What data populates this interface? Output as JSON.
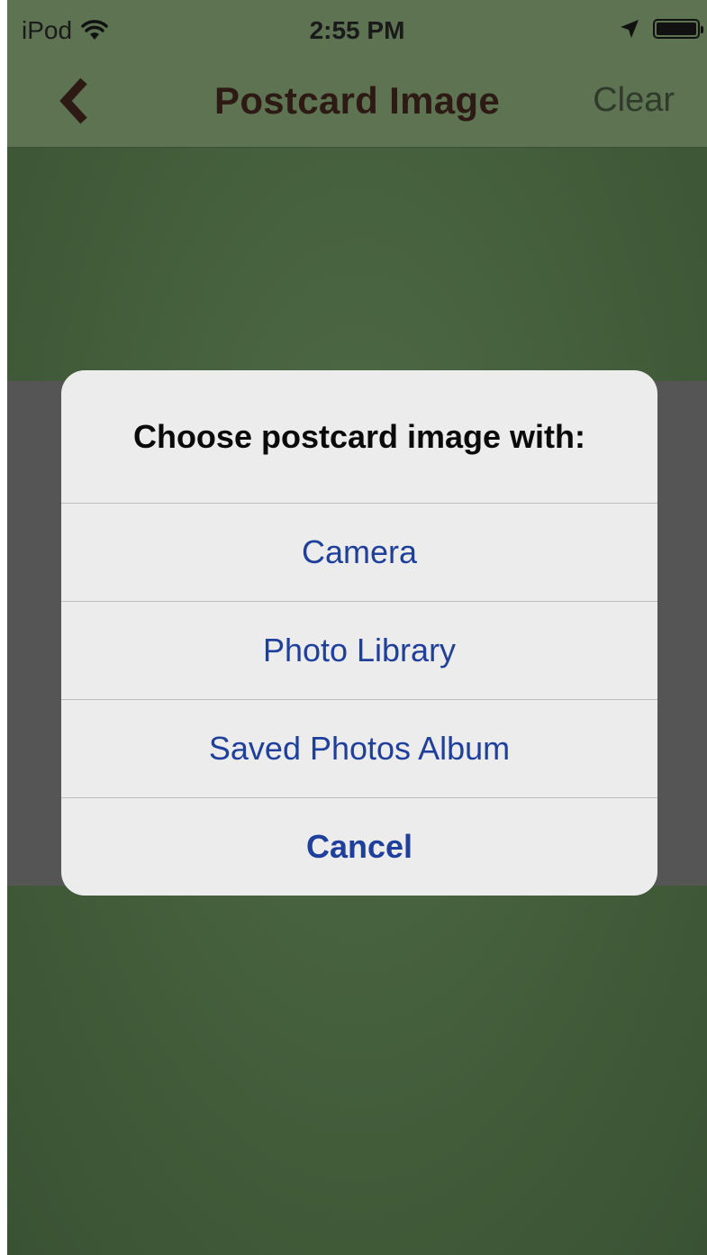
{
  "status_bar": {
    "carrier": "iPod",
    "time": "2:55 PM"
  },
  "nav_bar": {
    "title": "Postcard Image",
    "clear_label": "Clear"
  },
  "alert": {
    "title": "Choose postcard image with:",
    "options": [
      {
        "label": "Camera"
      },
      {
        "label": "Photo Library"
      },
      {
        "label": "Saved Photos Album"
      }
    ],
    "cancel_label": "Cancel"
  },
  "colors": {
    "nav_background": "#5d7352",
    "page_background": "#45603d",
    "title_text": "#2e1a14",
    "action_text": "#1f3f9c",
    "alert_background": "#ececec"
  },
  "icons": [
    "wifi-icon",
    "location-arrow-icon",
    "battery-icon",
    "back-chevron-icon"
  ]
}
